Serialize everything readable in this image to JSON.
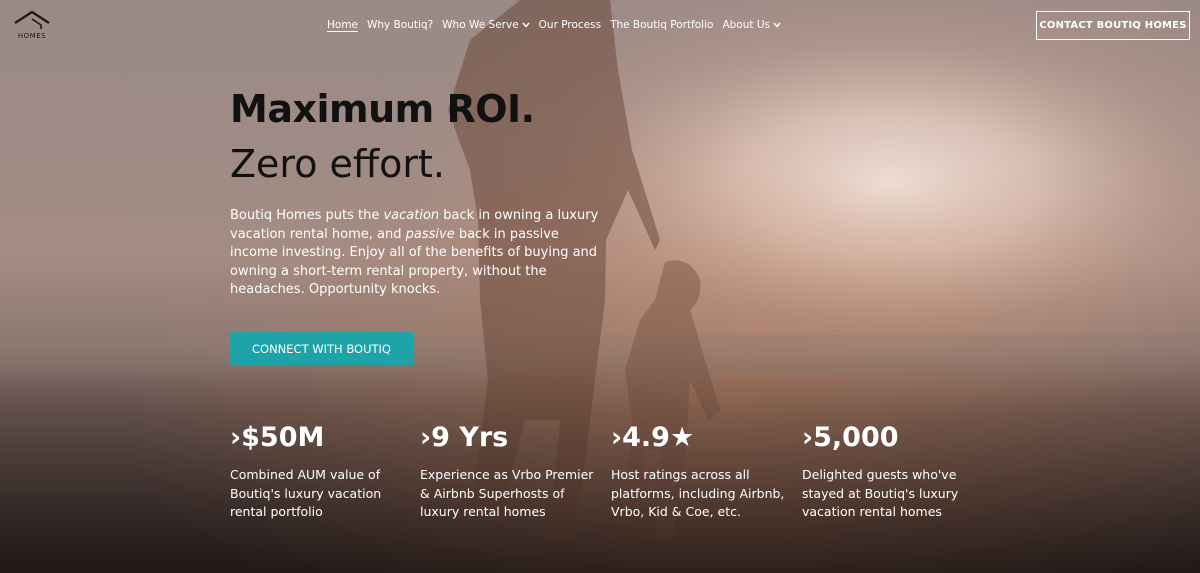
{
  "header": {
    "logo_text": "HOMES",
    "nav": [
      {
        "label": "Home",
        "active": true,
        "has_dropdown": false
      },
      {
        "label": "Why Boutiq?",
        "active": false,
        "has_dropdown": false
      },
      {
        "label": "Who We Serve",
        "active": false,
        "has_dropdown": true
      },
      {
        "label": "Our Process",
        "active": false,
        "has_dropdown": false
      },
      {
        "label": "The Boutiq Portfolio",
        "active": false,
        "has_dropdown": false
      },
      {
        "label": "About Us",
        "active": false,
        "has_dropdown": true
      }
    ],
    "contact_button": "CONTACT BOUTIQ HOMES"
  },
  "hero": {
    "headline_bold": "Maximum ROI.",
    "headline_light": "Zero effort.",
    "intro": {
      "part1": "Boutiq Homes puts the ",
      "em1": "vacation",
      "part2": " back in owning a luxury vacation rental home, and ",
      "em2": "passive",
      "part3": " back in passive income investing. Enjoy all of the benefits of buying and owning a short-term rental property, without the headaches. Opportunity knocks."
    },
    "cta_label": "CONNECT WITH BOUTIQ"
  },
  "stats": [
    {
      "value": "›$50M",
      "description": "Combined AUM value of Boutiq's luxury vacation rental portfolio"
    },
    {
      "value": "›9 Yrs",
      "description": "Experience as Vrbo Premier & Airbnb Superhosts of luxury rental homes"
    },
    {
      "value": "›4.9★",
      "description": "Host ratings across all platforms, including Airbnb, Vrbo, Kid & Coe, etc."
    },
    {
      "value": "›5,000",
      "description": "Delighted guests who've stayed at Boutiq's luxury vacation rental homes"
    }
  ],
  "colors": {
    "accent": "#1ea3a8",
    "text_dark": "#111111",
    "text_light": "#ffffff"
  }
}
